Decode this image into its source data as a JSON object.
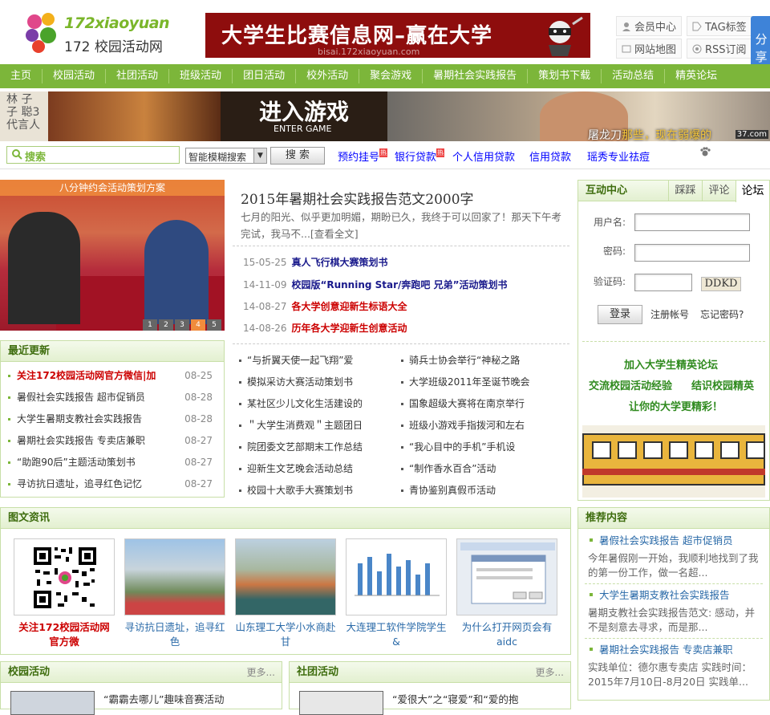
{
  "header": {
    "logo_en": "172xiaoyuan",
    "logo_cn": "172 校园活动网",
    "banner_title": "大学生比赛信息网–赢在大学",
    "banner_url": "bisai.172xiaoyuan.com",
    "links": [
      "会员中心",
      "TAG标签",
      "网站地图",
      "RSS订阅"
    ],
    "share": "分享"
  },
  "nav": [
    "主页",
    "校园活动",
    "社团活动",
    "班级活动",
    "团日活动",
    "校外活动",
    "聚会游戏",
    "暑期社会实践报告",
    "策划书下载",
    "活动总结",
    "精英论坛"
  ],
  "ads": {
    "left_text": [
      "林",
      "子",
      "代",
      "言",
      "人"
    ],
    "left_text2": [
      "子",
      "聪3"
    ],
    "game_big": "进入游戏",
    "game_small": "ENTER GAME",
    "right_caption_white": "屠龙刀",
    "right_caption_yellow": "那些，现在弱爆的",
    "right_watermark": "37.com"
  },
  "search": {
    "placeholder": "搜索",
    "mode": "智能模糊搜索",
    "button": "搜 索",
    "links": [
      {
        "text": "预约挂号",
        "hot": true
      },
      {
        "text": "银行贷款",
        "hot": true
      },
      {
        "text": "个人信用贷款",
        "hot": false
      },
      {
        "text": "信用贷款",
        "hot": false
      },
      {
        "text": "瑶秀专业祛痘",
        "hot": false
      }
    ]
  },
  "slide": {
    "caption": "八分钟约会活动策划方案",
    "pages": [
      "1",
      "2",
      "3",
      "4",
      "5"
    ],
    "active": 4,
    "badge": "172xiaoyuan"
  },
  "featured": {
    "title": "2015年暑期社会实践报告范文2000字",
    "summary": "七月的阳光、似乎更加明媚，期盼已久，我终于可以回家了！那天下午考完试，我马不...[查看全文]",
    "items": [
      {
        "date": "15-05-25",
        "title": "真人飞行棋大赛策划书",
        "color": "blue"
      },
      {
        "date": "14-11-09",
        "title": "校园版“Running Star/奔跑吧 兄弟”活动策划书",
        "color": "blue"
      },
      {
        "date": "14-08-27",
        "title": "各大学创意迎新生标语大全",
        "color": "red"
      },
      {
        "date": "14-08-26",
        "title": "历年各大学迎新生创意活动",
        "color": "red"
      }
    ],
    "grid_left": [
      "“与折翼天使一起飞翔”爱",
      "模拟采访大赛活动策划书",
      "某社区少儿文化生活建设的",
      "＂大学生消费观＂主题团日",
      "院团委文艺部期末工作总结",
      "迎新生文艺晚会活动总结",
      "校园十大歌手大赛策划书"
    ],
    "grid_right": [
      "骑兵士协会举行“神秘之路",
      "大学班级2011年圣诞节晚会",
      "国象超级大赛将在南京举行",
      "班级小游戏手指拨河和左右",
      "“我心目中的手机”手机设",
      "“制作香水百合”活动",
      "青协鉴别真假币活动"
    ]
  },
  "recent": {
    "title": "最近更新",
    "items": [
      {
        "title": "关注172校园活动网官方微信|加",
        "date": "08-25",
        "red": true
      },
      {
        "title": "暑假社会实践报告 超市促销员",
        "date": "08-28",
        "red": false
      },
      {
        "title": "大学生暑期支教社会实践报告",
        "date": "08-28",
        "red": false
      },
      {
        "title": "暑期社会实践报告 专卖店兼职",
        "date": "08-27",
        "red": false
      },
      {
        "title": "“助跑90后”主题活动策划书",
        "date": "08-27",
        "red": false
      },
      {
        "title": "寻访抗日遗址，追寻红色记忆",
        "date": "08-27",
        "red": false
      }
    ]
  },
  "login": {
    "title": "互动中心",
    "tabs": [
      "踩踩",
      "评论",
      "论坛"
    ],
    "username_label": "用户名:",
    "password_label": "密码:",
    "captcha_label": "验证码:",
    "captcha": "DDKD",
    "login_button": "登录",
    "register": "注册帐号",
    "forgot": "忘记密码?",
    "promo": [
      "加入大学生精英论坛",
      "交流校园活动经验",
      "结识校园精英",
      "让你的大学更精彩！"
    ]
  },
  "pics": {
    "title": "图文资讯",
    "items": [
      {
        "caption": "关注172校园活动网官方微",
        "red": true
      },
      {
        "caption": "寻访抗日遗址，追寻红色",
        "red": false
      },
      {
        "caption": "山东理工大学小水商赴甘",
        "red": false
      },
      {
        "caption": "大连理工软件学院学生&",
        "red": false
      },
      {
        "caption": "为什么打开网页会有aidc",
        "red": false
      }
    ]
  },
  "recommend": {
    "title": "推荐内容",
    "items": [
      {
        "title": "暑假社会实践报告 超市促销员",
        "desc": "今年暑假刚一开始，我顺利地找到了我的第一份工作，做一名超..."
      },
      {
        "title": "大学生暑期支教社会实践报告",
        "desc": "暑期支教社会实践报告范文: 感动，并不是刻意去寻求，而是那..."
      },
      {
        "title": "暑期社会实践报告 专卖店兼职",
        "desc": "实践单位：德尔惠专卖店 实践时间：2015年7月10日-8月20日 实践单..."
      }
    ]
  },
  "campus": {
    "title": "校园活动",
    "more": "更多...",
    "first": "“霸霸去哪儿”趣味音赛活动"
  },
  "club": {
    "title": "社团活动",
    "more": "更多...",
    "first": "“爱很大”之“寝爱”和“爱的抱"
  },
  "colors": {
    "nav_green": "#7cb63a",
    "header_green": "#3e6d0e",
    "link_blue": "#2a6aa8",
    "hot_red": "#cc0000",
    "share_blue": "#3e83d8"
  }
}
